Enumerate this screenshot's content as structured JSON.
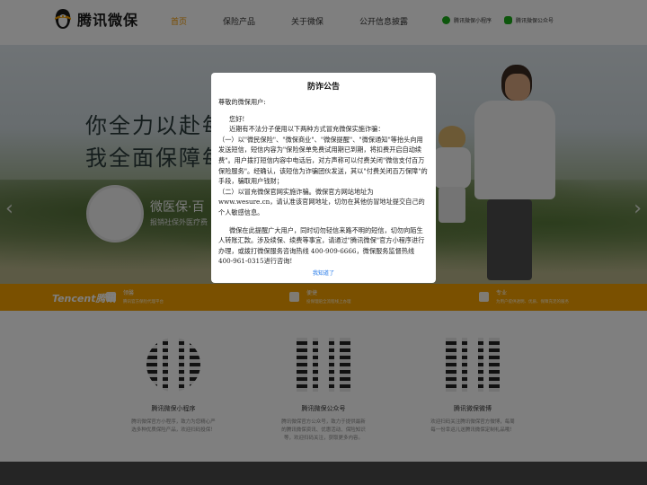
{
  "header": {
    "logo_text": "腾讯微保",
    "nav": [
      "首页",
      "保险产品",
      "关于微保",
      "公开信息披露"
    ],
    "links": [
      "腾讯微保小程序",
      "腾讯微保公众号"
    ]
  },
  "banner": {
    "title1": "你全力以赴每",
    "title2": "我全面保障每",
    "sub1": "微医保·百",
    "sub2": "报销社保外医疗费"
  },
  "strip": {
    "brand": "Tencent腾讯",
    "features": [
      {
        "title": "领馨",
        "desc": "腾讯官方保险代理平台"
      },
      {
        "title": "便捷",
        "desc": "投保理赔全流程线上办理"
      },
      {
        "title": "专业",
        "desc": "为用户提供透明、优质、保障充足的服务"
      }
    ]
  },
  "qr": [
    {
      "title": "腾讯微保小程序",
      "desc": "腾讯微保官方小程序，致力为您精心严选多种优质保险产品，欢迎扫码投保！"
    },
    {
      "title": "腾讯微保公众号",
      "desc": "腾讯微保官方公众号，致力于提供最新的腾讯微保资讯、优惠活动、保险知识等，欢迎扫码关注，获取更多内容。"
    },
    {
      "title": "腾讯微保微博",
      "desc": "欢迎扫码关注腾讯微保官方微博，每周每一份幸运儿送腾讯微保定制礼品哦！"
    }
  ],
  "modal": {
    "title": "防诈公告",
    "greeting": "尊敬的微保用户:",
    "hello": "您好!",
    "para1": "近期有不法分子使用以下两种方式冒充微保实施诈骗：",
    "item1": "（一）以\"微民保险\"、\"微保商业\"、\"微保提醒\"、\"微保通知\"等抬头向用发送短信，短信内容为\"保险保单免费试用期已到期，将扣费开启自动续费\"。用户拨打短信内容中电话后，对方声称可以付费关闭\"微信支付百万保险服务\"。经确认，该短信为诈骗团伙发送，其以\"付费关闭百万保障\"的手段，骗取用户钱财；",
    "item2": "（二）以冒充微保官网实施诈骗。微保官方网站地址为www.wesure.cn，请认准该官网地址，切勿在其他仿冒地址提交自己的个人敏感信息。",
    "para2": "微保在此提醒广大用户，同时切勿轻信来路不明的短信，切勿向陌生人转账汇款。涉及续保、续费等事宜，请通过\"腾讯微保\"官方小程序进行办理，或拨打微保服务咨询热线 400-909-6666，微保服务监督热线 400-961-0315进行咨询!",
    "ok": "我知道了"
  }
}
